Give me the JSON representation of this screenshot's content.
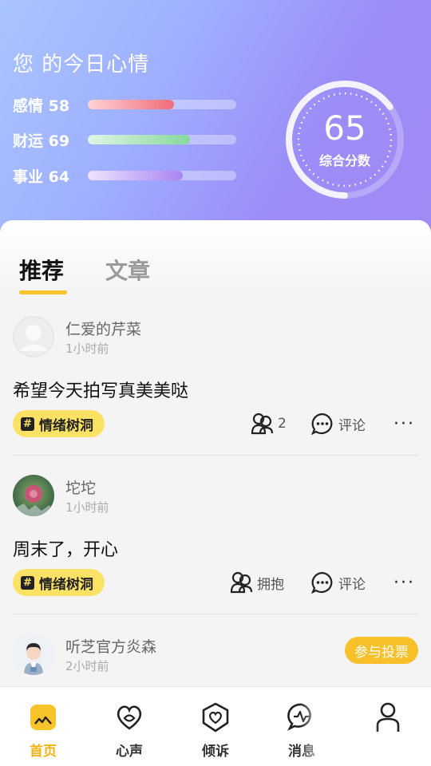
{
  "mood": {
    "title": "您 的今日心情",
    "items": [
      {
        "label": "感情",
        "value": "58",
        "level": 0.58,
        "color_from": "#ffd3d6",
        "color_to": "#f06c79"
      },
      {
        "label": "财运",
        "value": "69",
        "level": 0.69,
        "color_from": "#e0f5e6",
        "color_to": "#86d99b"
      },
      {
        "label": "事业",
        "value": "64",
        "level": 0.64,
        "color_from": "#eee3ff",
        "color_to": "#a985f0"
      }
    ],
    "score": {
      "value": "65",
      "label": "综合分数",
      "level": 0.65
    }
  },
  "tabs": {
    "recommend": "推荐",
    "articles": "文章"
  },
  "posts": [
    {
      "user": "仁爱的芹菜",
      "time": "1小时前",
      "content": "希望今天拍写真美美哒",
      "tag": "情绪树洞",
      "hug": "2",
      "comment": "评论"
    },
    {
      "user": "坨坨",
      "time": "1小时前",
      "content": "周末了，开心",
      "tag": "情绪树洞",
      "hug": "拥抱",
      "comment": "评论"
    },
    {
      "user": "听芝官方炎森",
      "time": "2小时前",
      "vote": "参与投票"
    }
  ],
  "nav": {
    "home": "首页",
    "voice": "心声",
    "confide": "倾诉",
    "messages": "消息",
    "profile": ""
  },
  "colors": {
    "accent": "#f7c52a",
    "tag_bg": "#fbe265"
  }
}
